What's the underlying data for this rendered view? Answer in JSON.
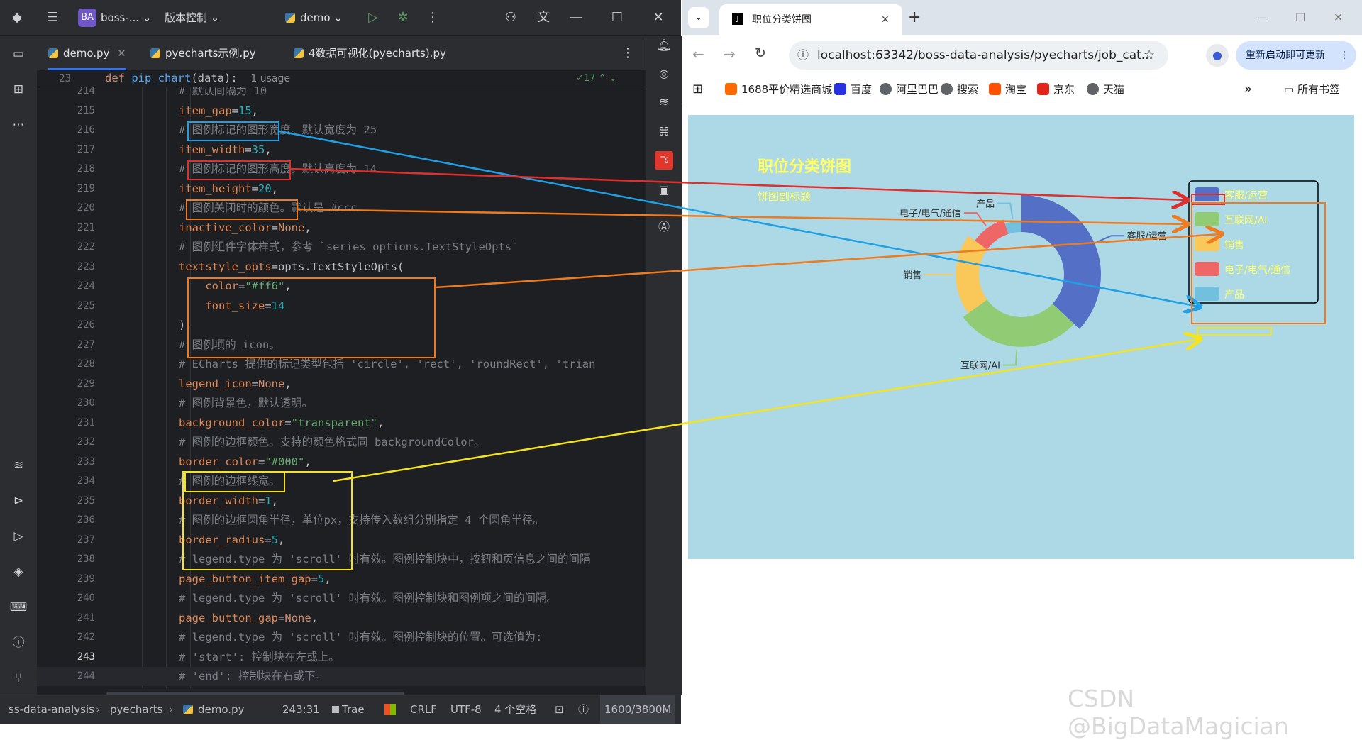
{
  "ide": {
    "project_badge": "BA",
    "project_name": "boss-...",
    "vcs": "版本控制",
    "run_config": "demo",
    "tabs": [
      {
        "label": "demo.py"
      },
      {
        "label": "pyecharts示例.py"
      },
      {
        "label": "4数据可视化(pyecharts).py"
      }
    ],
    "sticky": {
      "line": "23",
      "def_kw": "def",
      "func": "pip_chart",
      "args": "(data):",
      "usage": "1 usage",
      "checks": "17"
    },
    "lines": [
      {
        "n": "214",
        "seg": [
          [
            "cmt",
            "# 默认间隔为 10"
          ]
        ]
      },
      {
        "n": "215",
        "seg": [
          [
            "prm",
            "item_gap"
          ],
          [
            "plain",
            "="
          ],
          [
            "num",
            "15"
          ],
          [
            "plain",
            ","
          ]
        ]
      },
      {
        "n": "216",
        "seg": [
          [
            "cmt",
            "# 图例标记的图形宽度。默认宽度为 25"
          ]
        ]
      },
      {
        "n": "217",
        "seg": [
          [
            "prm",
            "item_width"
          ],
          [
            "plain",
            "="
          ],
          [
            "num",
            "35"
          ],
          [
            "plain",
            ","
          ]
        ]
      },
      {
        "n": "218",
        "seg": [
          [
            "cmt",
            "# 图例标记的图形高度。默认高度为 14"
          ]
        ]
      },
      {
        "n": "219",
        "seg": [
          [
            "prm",
            "item_height"
          ],
          [
            "plain",
            "="
          ],
          [
            "num",
            "20"
          ],
          [
            "plain",
            ","
          ]
        ]
      },
      {
        "n": "220",
        "seg": [
          [
            "cmt",
            "# 图例关闭时的颜色。默认是 #ccc"
          ]
        ]
      },
      {
        "n": "221",
        "seg": [
          [
            "prm",
            "inactive_color"
          ],
          [
            "plain",
            "="
          ],
          [
            "kw",
            "None"
          ],
          [
            "plain",
            ","
          ]
        ]
      },
      {
        "n": "222",
        "seg": [
          [
            "cmt",
            "# 图例组件字体样式，参考 `series_options.TextStyleOpts`"
          ]
        ]
      },
      {
        "n": "223",
        "seg": [
          [
            "prm",
            "textstyle_opts"
          ],
          [
            "plain",
            "=opts.TextStyleOpts("
          ]
        ]
      },
      {
        "n": "224",
        "seg": [
          [
            "plain",
            "    "
          ],
          [
            "prm",
            "color"
          ],
          [
            "plain",
            "="
          ],
          [
            "str",
            "\"#ff6\""
          ],
          [
            "plain",
            ","
          ]
        ]
      },
      {
        "n": "225",
        "seg": [
          [
            "plain",
            "    "
          ],
          [
            "prm",
            "font_size"
          ],
          [
            "plain",
            "="
          ],
          [
            "num",
            "14"
          ]
        ]
      },
      {
        "n": "226",
        "seg": [
          [
            "plain",
            "),"
          ]
        ]
      },
      {
        "n": "227",
        "seg": [
          [
            "cmt",
            "# 图例项的 icon。"
          ]
        ]
      },
      {
        "n": "228",
        "seg": [
          [
            "cmt",
            "# ECharts 提供的标记类型包括 'circle', 'rect', 'roundRect', 'trian"
          ]
        ]
      },
      {
        "n": "229",
        "seg": [
          [
            "prm",
            "legend_icon"
          ],
          [
            "plain",
            "="
          ],
          [
            "kw",
            "None"
          ],
          [
            "plain",
            ","
          ]
        ]
      },
      {
        "n": "230",
        "seg": [
          [
            "cmt",
            "# 图例背景色，默认透明。"
          ]
        ]
      },
      {
        "n": "231",
        "seg": [
          [
            "prm",
            "background_color"
          ],
          [
            "plain",
            "="
          ],
          [
            "str",
            "\"transparent\""
          ],
          [
            "plain",
            ","
          ]
        ]
      },
      {
        "n": "232",
        "seg": [
          [
            "cmt",
            "# 图例的边框颜色。支持的颜色格式同 backgroundColor。"
          ]
        ]
      },
      {
        "n": "233",
        "seg": [
          [
            "prm",
            "border_color"
          ],
          [
            "plain",
            "="
          ],
          [
            "str",
            "\"#000\""
          ],
          [
            "plain",
            ","
          ]
        ]
      },
      {
        "n": "234",
        "seg": [
          [
            "cmt",
            "# 图例的边框线宽。"
          ]
        ]
      },
      {
        "n": "235",
        "seg": [
          [
            "prm",
            "border_width"
          ],
          [
            "plain",
            "="
          ],
          [
            "num",
            "1"
          ],
          [
            "plain",
            ","
          ]
        ]
      },
      {
        "n": "236",
        "seg": [
          [
            "cmt",
            "# 图例的边框圆角半径，单位px，支持传入数组分别指定 4 个圆角半径。"
          ]
        ]
      },
      {
        "n": "237",
        "seg": [
          [
            "prm",
            "border_radius"
          ],
          [
            "plain",
            "="
          ],
          [
            "num",
            "5"
          ],
          [
            "plain",
            ","
          ]
        ]
      },
      {
        "n": "238",
        "seg": [
          [
            "cmt",
            "# legend.type 为 'scroll' 时有效。图例控制块中，按钮和页信息之间的间隔"
          ]
        ]
      },
      {
        "n": "239",
        "seg": [
          [
            "prm",
            "page_button_item_gap"
          ],
          [
            "plain",
            "="
          ],
          [
            "num",
            "5"
          ],
          [
            "plain",
            ","
          ]
        ]
      },
      {
        "n": "240",
        "seg": [
          [
            "cmt",
            "# legend.type 为 'scroll' 时有效。图例控制块和图例项之间的间隔。"
          ]
        ]
      },
      {
        "n": "241",
        "seg": [
          [
            "prm",
            "page_button_gap"
          ],
          [
            "plain",
            "="
          ],
          [
            "kw",
            "None"
          ],
          [
            "plain",
            ","
          ]
        ]
      },
      {
        "n": "242",
        "seg": [
          [
            "cmt",
            "# legend.type 为 'scroll' 时有效。图例控制块的位置。可选值为:"
          ]
        ]
      },
      {
        "n": "243",
        "seg": [
          [
            "cmt",
            "# 'start': 控制块在左或上。"
          ]
        ]
      },
      {
        "n": "244",
        "seg": [
          [
            "cmt",
            "# 'end': 控制块在右或下。"
          ]
        ]
      }
    ],
    "status": {
      "path1": "ss-data-analysis",
      "path2": "pyecharts",
      "path3": "demo.py",
      "position": "243:31",
      "trae": "Trae",
      "eol": "CRLF",
      "encoding": "UTF-8",
      "indent": "4 个空格",
      "memory": "1600/3800M"
    }
  },
  "browser": {
    "tab_title": "职位分类饼图",
    "url": "localhost:63342/boss-data-analysis/pyecharts/job_cat...",
    "update_button": "重新启动即可更新",
    "bookmarks": [
      {
        "label": "1688平价精选商城",
        "color": "#ff6a00"
      },
      {
        "label": "百度",
        "color": "#2932e1"
      },
      {
        "label": "阿里巴巴",
        "color": "#5f6368"
      },
      {
        "label": "搜索",
        "color": "#5f6368"
      },
      {
        "label": "淘宝",
        "color": "#ff5000"
      },
      {
        "label": "京东",
        "color": "#e1251b"
      },
      {
        "label": "天猫",
        "color": "#5f6368"
      }
    ],
    "all_bookmarks": "所有书签"
  },
  "chart_data": {
    "type": "pie",
    "title": "职位分类饼图",
    "subtitle": "饼图副标题",
    "background": "#add8e6",
    "legend_position": "top-right",
    "legend_text_color": "#ffff66",
    "legend_border_color": "#000",
    "categories": [
      "客服/运营",
      "互联网/AI",
      "销售",
      "电子/电气/通信",
      "产品"
    ],
    "values": [
      37,
      28,
      20,
      10,
      5
    ],
    "colors": [
      "#5470c6",
      "#91cc75",
      "#fac858",
      "#ee6666",
      "#73c0de"
    ]
  },
  "watermark": "CSDN @BigDataMagician"
}
